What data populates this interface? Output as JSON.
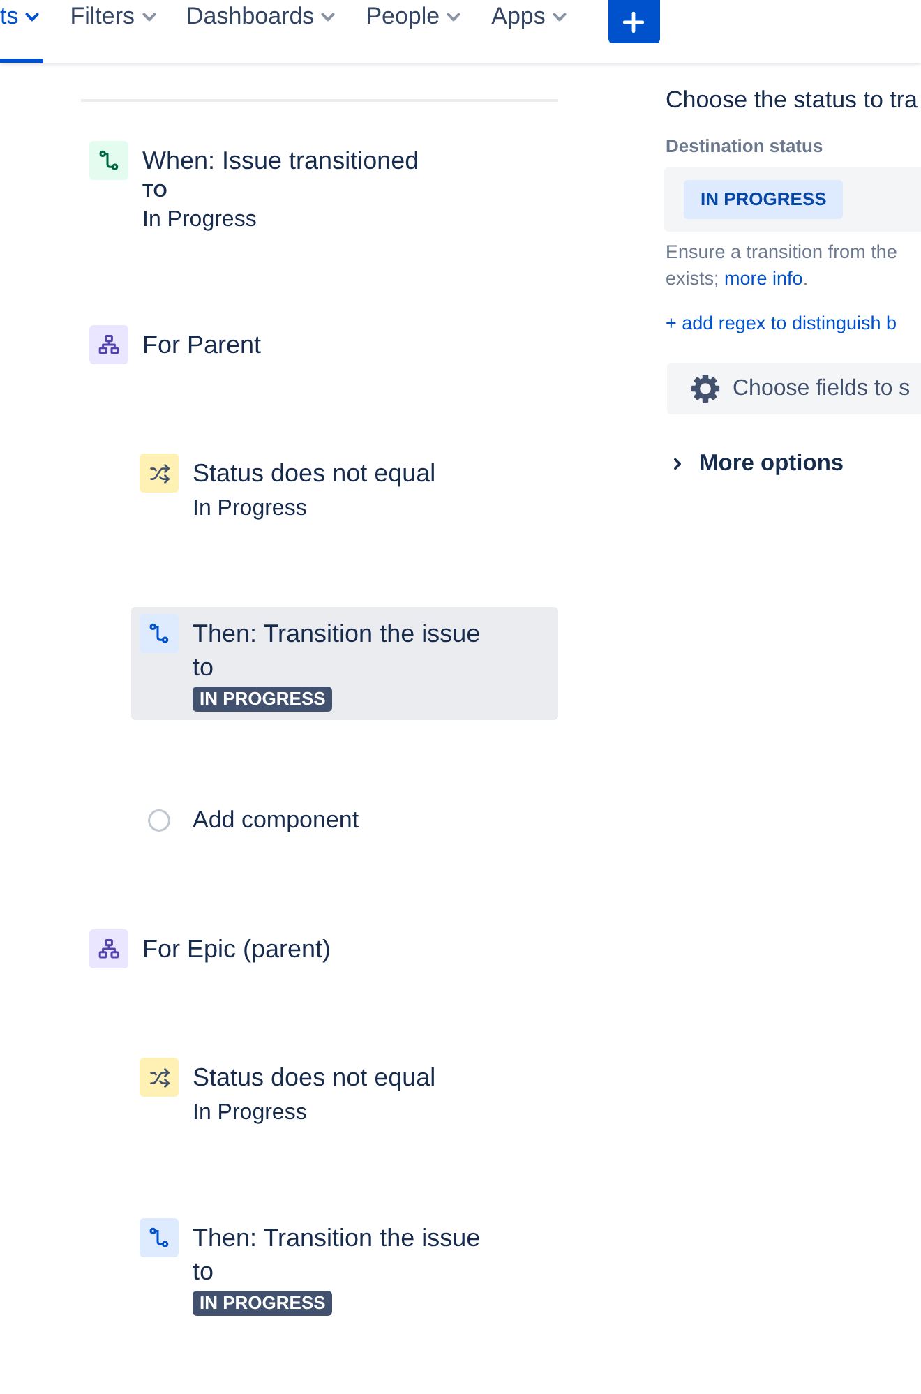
{
  "nav": {
    "items": [
      {
        "label": "ts",
        "selected": true
      },
      {
        "label": "Filters",
        "selected": false
      },
      {
        "label": "Dashboards",
        "selected": false
      },
      {
        "label": "People",
        "selected": false
      },
      {
        "label": "Apps",
        "selected": false
      }
    ]
  },
  "rule": {
    "components": [
      {
        "kind": "trigger",
        "selected": false,
        "title": "When: Issue transitioned",
        "label": "TO",
        "value": "In Progress"
      },
      {
        "kind": "branch",
        "selected": false,
        "title": "For Parent",
        "children": [
          {
            "kind": "condition",
            "selected": false,
            "title": "Status does not equal",
            "value": "In Progress"
          },
          {
            "kind": "action",
            "selected": true,
            "title": "Then: Transition the issue to",
            "status": "IN PROGRESS"
          },
          {
            "kind": "add",
            "selected": false,
            "title": "Add component"
          }
        ]
      },
      {
        "kind": "branch",
        "selected": false,
        "title": "For Epic (parent)",
        "children": [
          {
            "kind": "condition",
            "selected": false,
            "title": "Status does not equal",
            "value": "In Progress"
          },
          {
            "kind": "action",
            "selected": false,
            "title": "Then: Transition the issue to",
            "status": "IN PROGRESS"
          }
        ]
      }
    ]
  },
  "panel": {
    "heading": "Choose the status to tra",
    "field_label": "Destination status",
    "field": {
      "value": "IN PROGRESS"
    },
    "hint": {
      "line_1": "Ensure a transition from the",
      "line_2": "exists;",
      "link": "more info",
      "end": "."
    },
    "regex_link": "+ add regex to distinguish b",
    "fields_button": "Choose fields to s",
    "more_options": {
      "label": "More options",
      "expanded": false
    }
  }
}
